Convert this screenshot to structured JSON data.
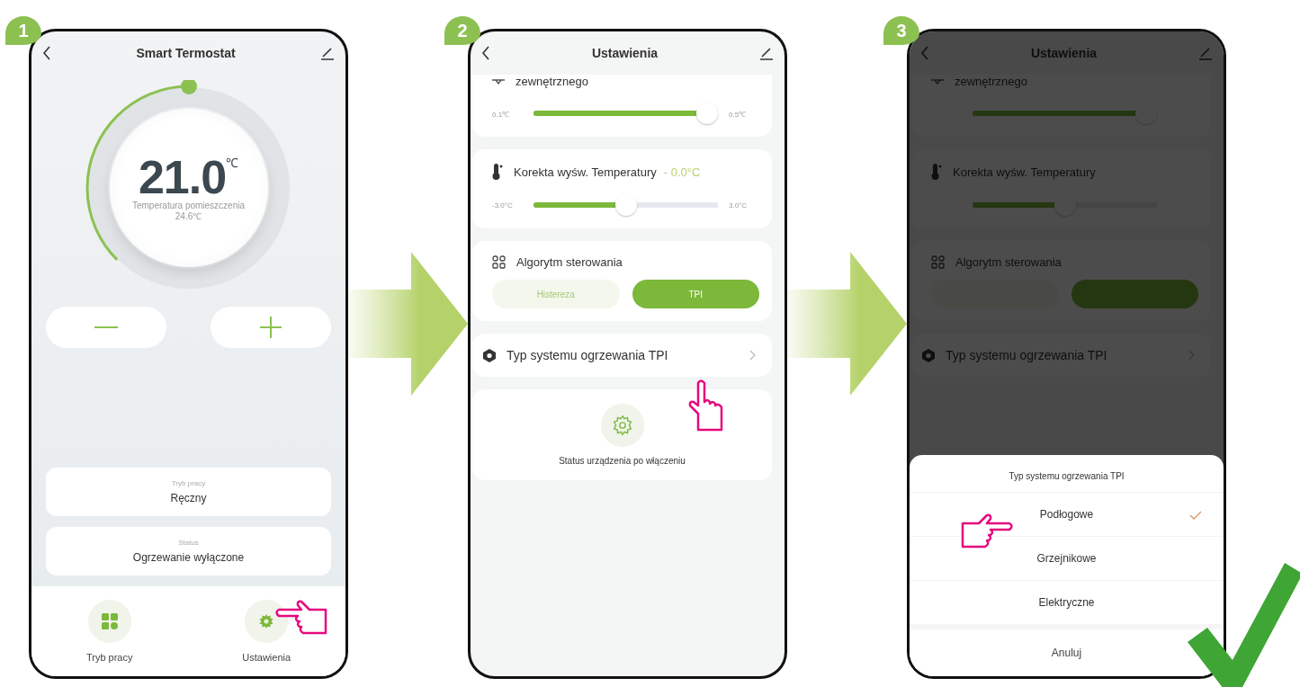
{
  "steps": [
    {
      "number": "1",
      "kind": "thermostat",
      "title": "Smart Termostat",
      "setpoint": "21.0",
      "unit": "℃",
      "level": 0.5,
      "room_label": "Temperatura pomieszczenia",
      "room_temp": "24.6℃",
      "cards": [
        {
          "label": "Tryb pracy",
          "value": "Ręczny"
        },
        {
          "label": "Status",
          "value": "Ogrzewanie wyłączone"
        }
      ],
      "nav": [
        {
          "kind": "grid",
          "label": "Tryb pracy"
        },
        {
          "kind": "gear",
          "label": "Ustawienia"
        }
      ]
    },
    {
      "number": "2",
      "kind": "settings",
      "title": "Ustawienia",
      "sections": [
        {
          "kind": "slider",
          "label": "zewnętrznego",
          "min": "0.1℃",
          "max": "0.5℃",
          "level": 1.0
        },
        {
          "kind": "slider",
          "label": "Korekta wyśw. Temperatury",
          "value": "- 0.0°C",
          "min": "-3.0°C",
          "max": "3.0°C",
          "level": 0.5
        },
        {
          "kind": "segmented",
          "label": "Algorytm sterowania",
          "options": [
            {
              "label": "Histereza",
              "selected": false
            },
            {
              "label": "TPI",
              "selected": true
            }
          ]
        },
        {
          "kind": "link",
          "label": "Typ systemu ogrzewania TPI"
        },
        {
          "kind": "tile",
          "label": "Status urządzenia po włączeniu"
        }
      ]
    },
    {
      "number": "3",
      "kind": "settings",
      "title": "Ustawienia",
      "sections": [
        {
          "kind": "slider",
          "label": "zewnętrznego",
          "level": 1.0
        },
        {
          "kind": "slider",
          "label": "Korekta wyśw. Temperatury",
          "level": 0.5
        },
        {
          "kind": "segmented",
          "label": "Algorytm sterowania",
          "options": [
            {
              "selected": false
            },
            {
              "selected": true
            }
          ]
        },
        {
          "kind": "link",
          "label": "Typ systemu ogrzewania TPI"
        }
      ],
      "sheet": {
        "title": "Typ systemu ogrzewania TPI",
        "options": [
          {
            "label": "Podłogowe",
            "selected": true
          },
          {
            "label": "Grzejnikowe",
            "selected": false
          },
          {
            "label": "Elektryczne",
            "selected": false
          }
        ],
        "cancel": "Anuluj"
      }
    }
  ]
}
